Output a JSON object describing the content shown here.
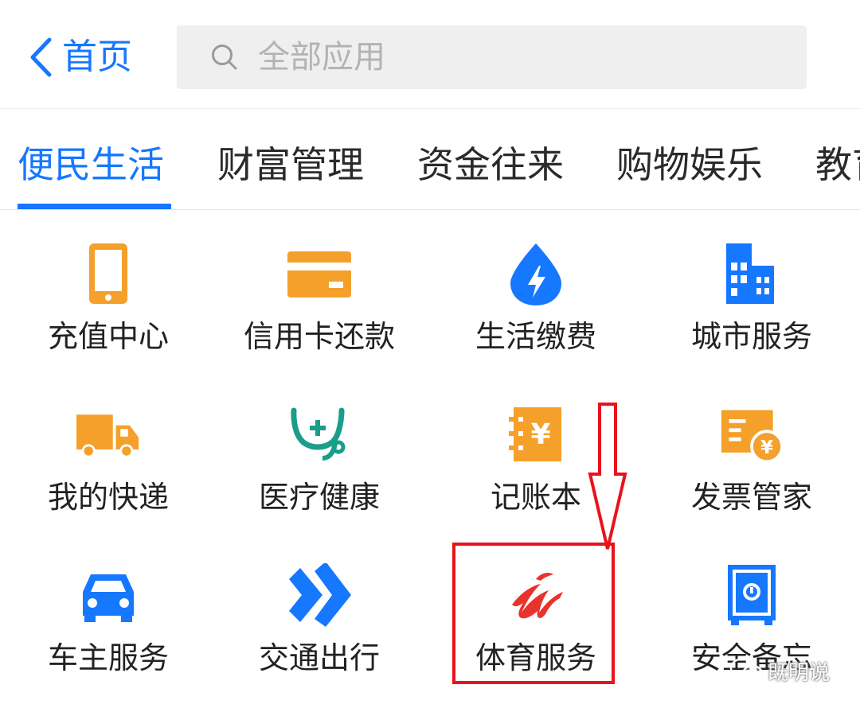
{
  "header": {
    "back_label": "首页",
    "search_placeholder": "全部应用"
  },
  "tabs": [
    {
      "label": "便民生活",
      "active": true
    },
    {
      "label": "财富管理",
      "active": false
    },
    {
      "label": "资金往来",
      "active": false
    },
    {
      "label": "购物娱乐",
      "active": false
    },
    {
      "label": "教育",
      "active": false
    }
  ],
  "apps": [
    {
      "label": "充值中心",
      "icon": "phone-icon"
    },
    {
      "label": "信用卡还款",
      "icon": "credit-card-icon"
    },
    {
      "label": "生活缴费",
      "icon": "water-drop-bolt-icon"
    },
    {
      "label": "城市服务",
      "icon": "city-buildings-icon"
    },
    {
      "label": "我的快递",
      "icon": "delivery-truck-icon"
    },
    {
      "label": "医疗健康",
      "icon": "stethoscope-icon"
    },
    {
      "label": "记账本",
      "icon": "ledger-book-icon"
    },
    {
      "label": "发票管家",
      "icon": "invoice-icon"
    },
    {
      "label": "车主服务",
      "icon": "car-icon"
    },
    {
      "label": "交通出行",
      "icon": "double-chevron-icon"
    },
    {
      "label": "体育服务",
      "icon": "sports-logo-icon"
    },
    {
      "label": "安全备忘",
      "icon": "safe-box-icon"
    }
  ],
  "colors": {
    "accent": "#1677ff",
    "orange": "#f5a02b",
    "teal": "#1a9e8a",
    "red": "#e8332c",
    "annotation": "#e8131b"
  },
  "watermark": {
    "text": "既明说"
  }
}
